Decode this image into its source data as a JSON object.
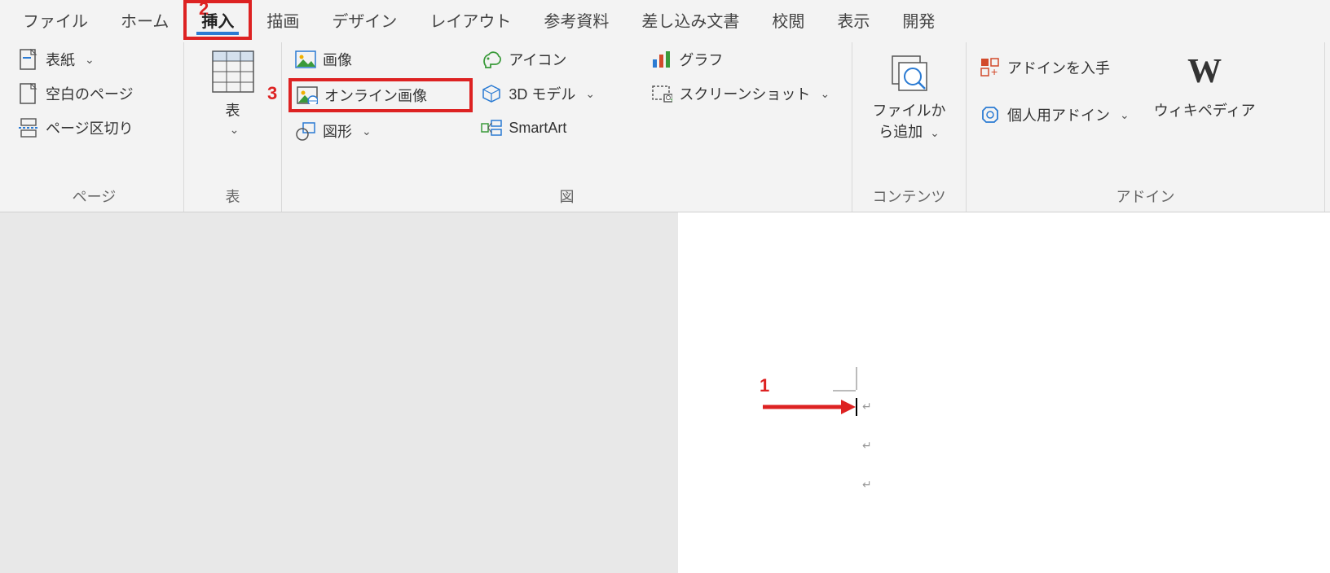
{
  "tabs": {
    "file": "ファイル",
    "home": "ホーム",
    "insert": "挿入",
    "draw": "描画",
    "design": "デザイン",
    "layout": "レイアウト",
    "references": "参考資料",
    "mailings": "差し込み文書",
    "review": "校閲",
    "view": "表示",
    "developer": "開発"
  },
  "groups": {
    "pages": {
      "label": "ページ",
      "cover": "表紙",
      "blank": "空白のページ",
      "break": "ページ区切り"
    },
    "tables": {
      "label": "表",
      "table": "表"
    },
    "illustrations": {
      "label": "図",
      "pictures": "画像",
      "online_pictures": "オンライン画像",
      "shapes": "図形",
      "icons": "アイコン",
      "models3d": "3D モデル",
      "smartart": "SmartArt",
      "chart": "グラフ",
      "screenshot": "スクリーンショット"
    },
    "content": {
      "label": "コンテンツ",
      "reuse": "ファイルから追加"
    },
    "addins": {
      "label": "アドイン",
      "get": "アドインを入手",
      "my": "個人用アドイン",
      "wiki": "ウィキペディア"
    }
  },
  "annotations": {
    "n1": "1",
    "n2": "2",
    "n3": "3"
  }
}
